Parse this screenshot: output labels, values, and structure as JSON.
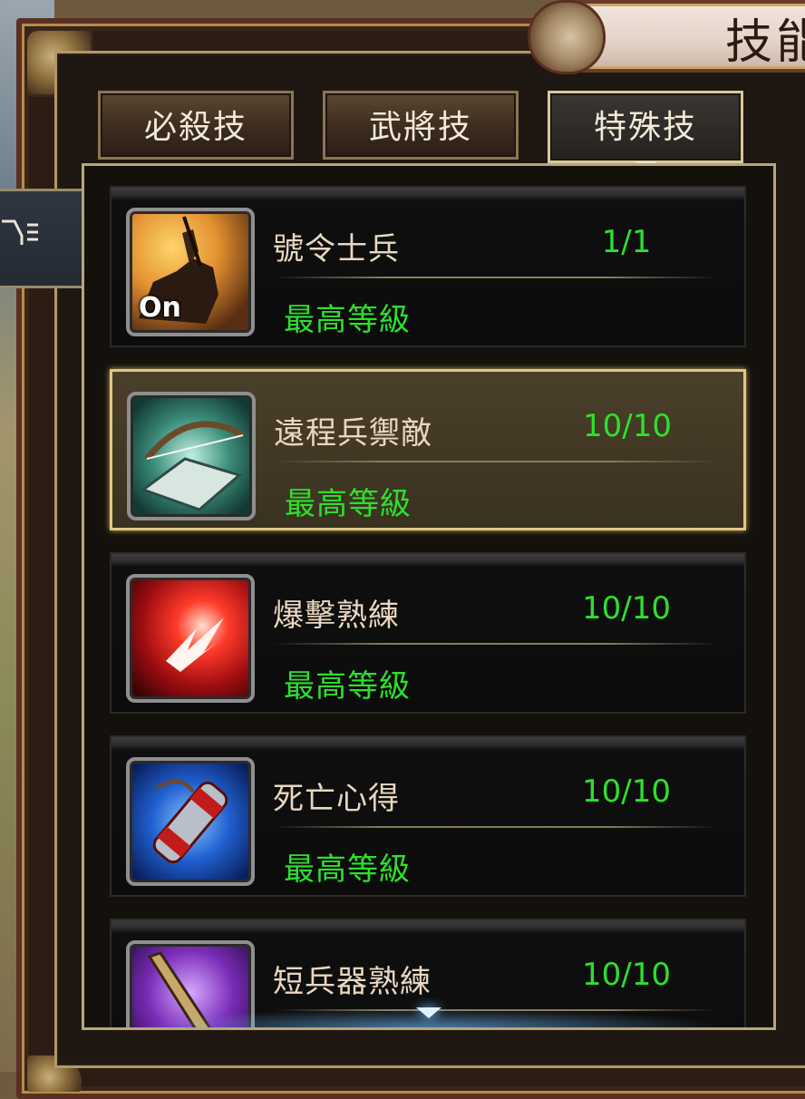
{
  "header": {
    "title": "技能"
  },
  "tabs": [
    {
      "label": "必殺技",
      "active": false
    },
    {
      "label": "武將技",
      "active": false
    },
    {
      "label": "特殊技",
      "active": true
    }
  ],
  "skills": [
    {
      "name": "號令士兵",
      "level": "1/1",
      "status": "最高等級",
      "icon": "mounted-commander-icon",
      "badge": "On",
      "selected": false
    },
    {
      "name": "遠程兵禦敵",
      "level": "10/10",
      "status": "最高等級",
      "icon": "bow-book-icon",
      "badge": "",
      "selected": true
    },
    {
      "name": "爆擊熟練",
      "level": "10/10",
      "status": "最高等級",
      "icon": "critical-strike-icon",
      "badge": "",
      "selected": false
    },
    {
      "name": "死亡心得",
      "level": "10/10",
      "status": "最高等級",
      "icon": "scroll-icon",
      "badge": "",
      "selected": false
    },
    {
      "name": "短兵器熟練",
      "level": "10/10",
      "status": "",
      "icon": "dagger-icon",
      "badge": "",
      "selected": false
    }
  ],
  "colors": {
    "level_green": "#2de02d",
    "name_text": "#e9d7c0",
    "selected_border": "#e0c784"
  }
}
